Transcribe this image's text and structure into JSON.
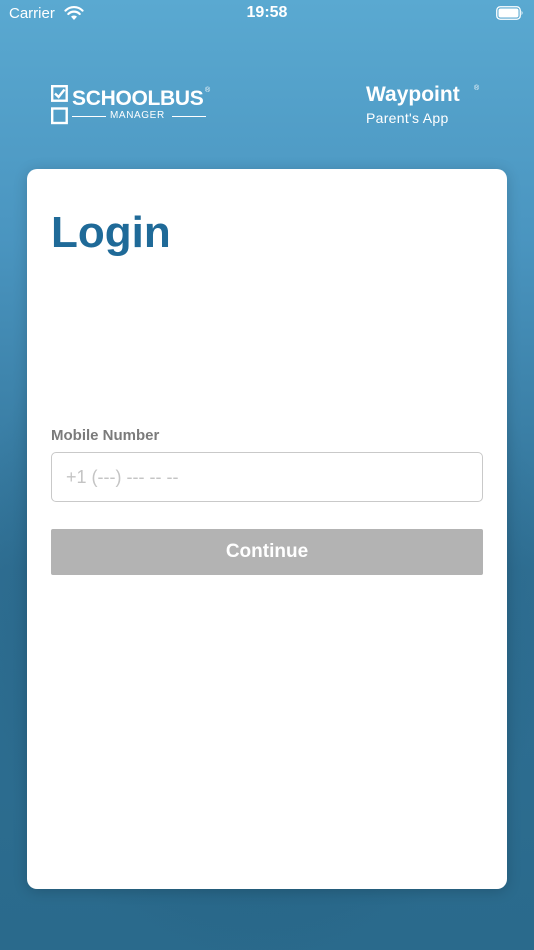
{
  "status_bar": {
    "carrier": "Carrier",
    "time": "19:58",
    "wifi_icon": "wifi-icon",
    "battery_icon": "battery-icon"
  },
  "header": {
    "left_logo": {
      "name": "SCHOOLBUS",
      "sub": "MANAGER",
      "registered": "®",
      "icon": "checkbox-icon"
    },
    "right_logo": {
      "name": "Waypoint",
      "registered": "®",
      "sub": "Parent's App"
    }
  },
  "login": {
    "title": "Login",
    "mobile_label": "Mobile Number",
    "mobile_placeholder": "+1 (---) --- -- --",
    "mobile_value": "",
    "continue_label": "Continue"
  },
  "colors": {
    "title": "#1f6a98",
    "button_disabled": "#b3b3b3",
    "label": "#7b7b7b",
    "card": "#ffffff"
  }
}
